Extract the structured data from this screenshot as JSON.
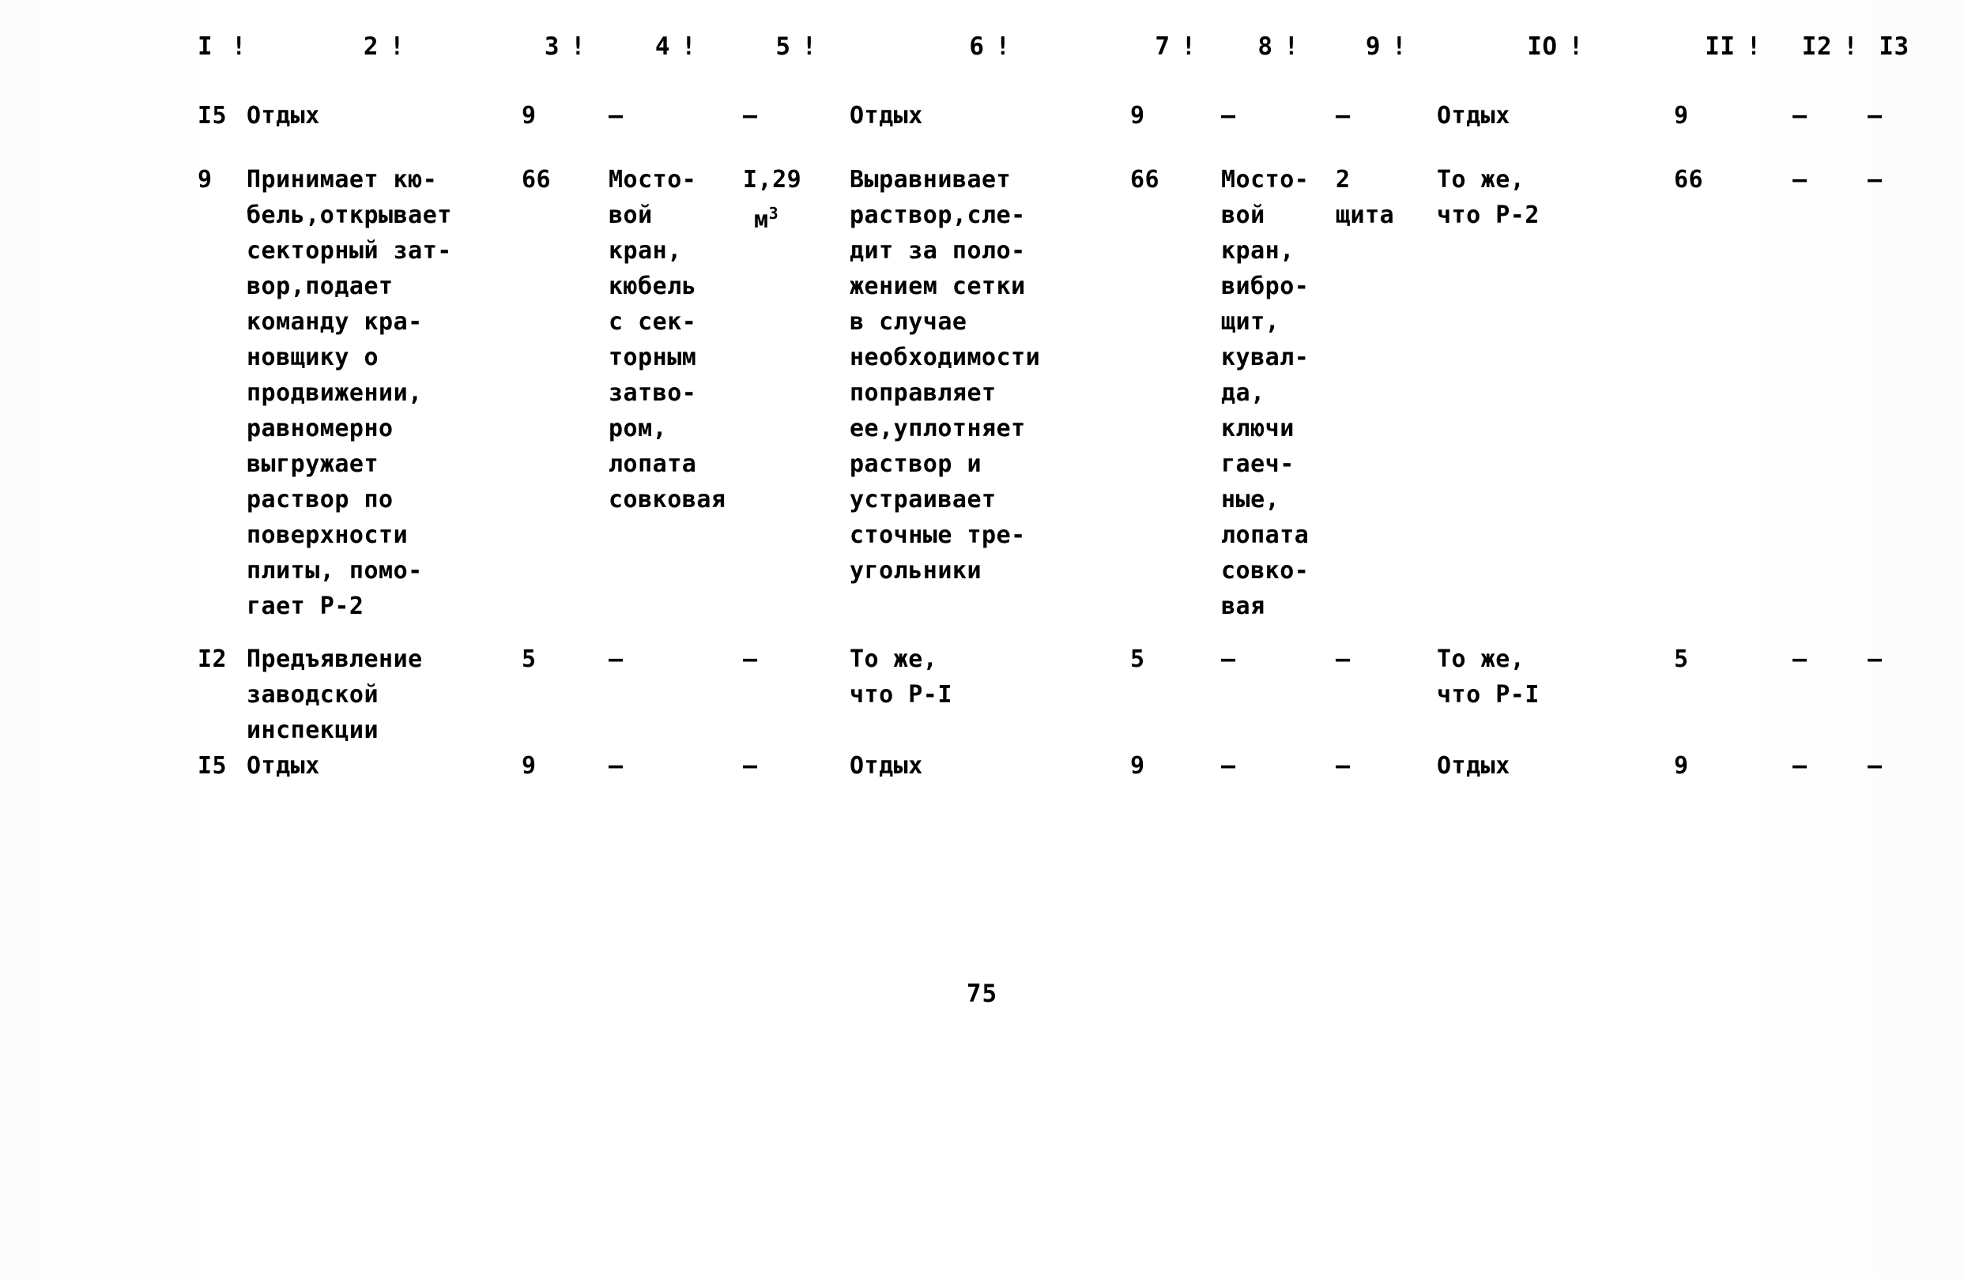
{
  "document": {
    "page_number": "75",
    "column_numbers": [
      "I",
      "2",
      "3",
      "4",
      "5",
      "6",
      "7",
      "8",
      "9",
      "IO",
      "II",
      "I2",
      "I3"
    ],
    "separator": "!"
  },
  "table": {
    "rows": [
      {
        "c1": "I5",
        "c2": "Отдых",
        "c3": "9",
        "c4": "–",
        "c5": "–",
        "c6": "Отдых",
        "c7": "9",
        "c8": "–",
        "c9": "–",
        "c10": "Отдых",
        "c11": "9",
        "c12": "–",
        "c13": "–"
      },
      {
        "c1": "9",
        "c2": "Принимает кю-\nбель,открывает\nсекторный зат-\nвор,подает\nкоманду кра-\nновщику о\nпродвижении,\nравномерно\nвыгружает\nраствор по\nповерхности\nплиты, помо-\nгает Р-2",
        "c3": "66",
        "c4": "Мосто-\nвой\nкран,\nкюбель\nс сек-\nторным\nзатво-\nром,\nлопата\nсовковая",
        "c5": "I,29",
        "c5_unit": "м",
        "c5_unit_sup": "3",
        "c6": "Выравнивает\nраствор,сле-\nдит за поло-\nжением сетки\nв случае\nнеобходимости\nпоправляет\nее,уплотняет\nраствор и\nустраивает\nсточные тре-\nугольники",
        "c7": "66",
        "c8": "Мосто-\nвой\nкран,\nвибро-\nщит,\nкувал-\nда,\nключи\nгаеч-\nные,\nлопата\nсовко-\nвая",
        "c9": "2\nщита",
        "c10": "То же,\nчто Р-2",
        "c11": "66",
        "c12": "–",
        "c13": "–"
      },
      {
        "c1": "I2",
        "c2": "Предъявление\nзаводской\nинспекции",
        "c3": "5",
        "c4": "–",
        "c5": "–",
        "c6": "То же,\nчто Р-I",
        "c7": "5",
        "c8": "–",
        "c9": "–",
        "c10": "То же,\nчто Р-I",
        "c11": "5",
        "c12": "–",
        "c13": "–"
      },
      {
        "c1": "I5",
        "c2": "Отдых",
        "c3": "9",
        "c4": "–",
        "c5": "–",
        "c6": "Отдых",
        "c7": "9",
        "c8": "–",
        "c9": "–",
        "c10": "Отдых",
        "c11": "9",
        "c12": "–",
        "c13": "–"
      }
    ]
  }
}
